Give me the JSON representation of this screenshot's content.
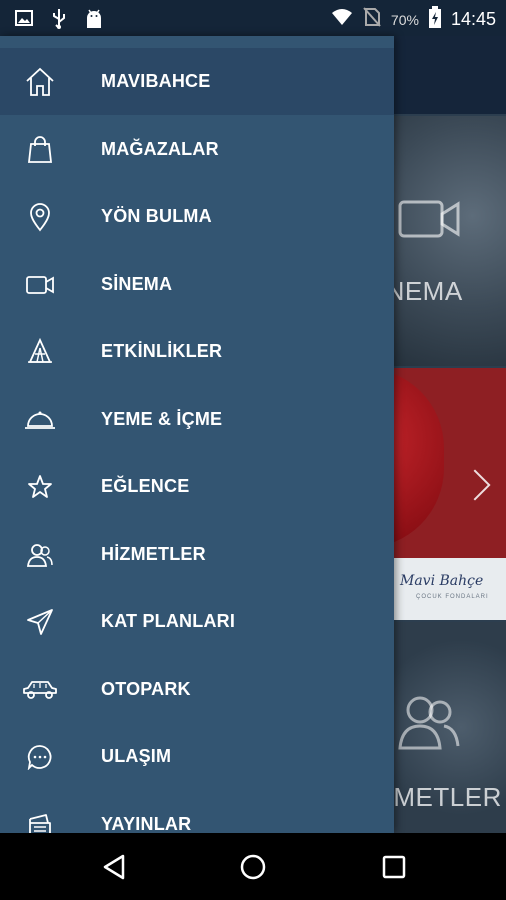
{
  "status_bar": {
    "battery": "70%",
    "time": "14:45",
    "icons": [
      "image-icon",
      "usb-icon",
      "android-icon",
      "wifi-icon",
      "no-sim-icon",
      "battery-charging-icon"
    ]
  },
  "menu": {
    "items": [
      {
        "label": "MAVIBAHCE",
        "icon": "home-icon",
        "active": true
      },
      {
        "label": "MAĞAZALAR",
        "icon": "shopping-bag-icon"
      },
      {
        "label": "YÖN BULMA",
        "icon": "location-pin-icon"
      },
      {
        "label": "SİNEMA",
        "icon": "video-camera-icon"
      },
      {
        "label": "ETKİNLİKLER",
        "icon": "event-tent-icon"
      },
      {
        "label": "YEME & İÇME",
        "icon": "food-cloche-icon"
      },
      {
        "label": "EĞLENCE",
        "icon": "star-icon"
      },
      {
        "label": "HİZMETLER",
        "icon": "people-icon"
      },
      {
        "label": "KAT PLANLARI",
        "icon": "send-arrow-icon"
      },
      {
        "label": "OTOPARK",
        "icon": "car-icon"
      },
      {
        "label": "ULAŞIM",
        "icon": "chat-bubble-icon"
      },
      {
        "label": "YAYINLAR",
        "icon": "publication-icon"
      }
    ]
  },
  "background": {
    "tile1_label": "SİNEMA",
    "tile2_script": "Mavi Bahçe",
    "tile2_sub": "ÇOCUK FONDALARI",
    "tile3_label": "HİZMETLER"
  },
  "colors": {
    "drawer": "#335572",
    "active_item": "#2b4866",
    "status_bar": "#142538"
  }
}
